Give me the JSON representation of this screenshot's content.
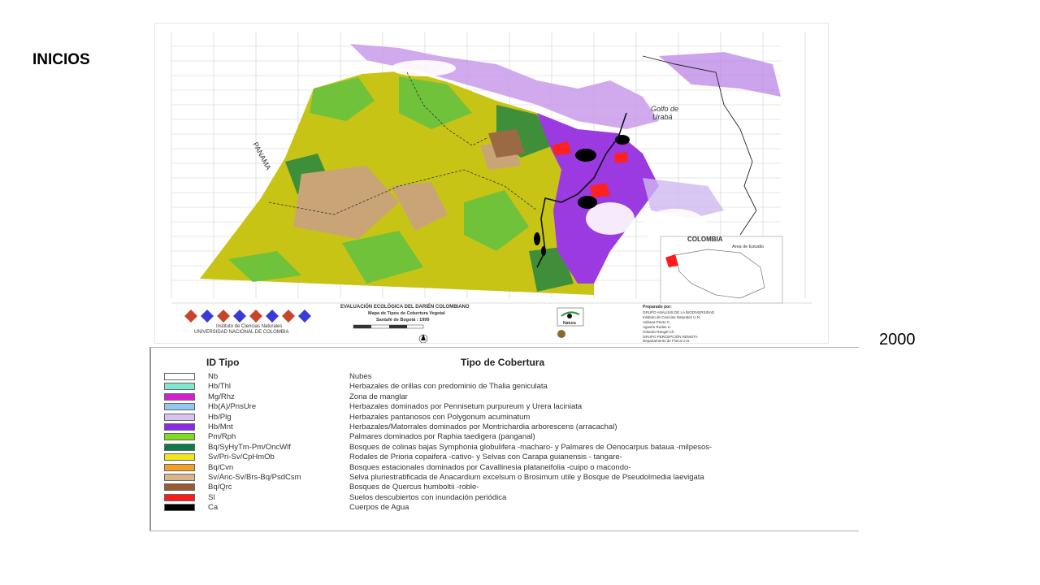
{
  "slide": {
    "title": "INICIOS",
    "year": "2000"
  },
  "map": {
    "country_label": "PANAMA",
    "gulf_label_line1": "Golfo de",
    "gulf_label_line2": "Urabá",
    "inset_title": "COLOMBIA",
    "inset_subtitle": "Area de Estudio",
    "footer": {
      "project_title": "EVALUACIÓN ECOLÓGICA DEL DARIÉN COLOMBIANO",
      "map_title": "Mapa de Tipos de Cobertura Vegetal",
      "place_year": "Santafé de Bogotá : 1999",
      "institute_line1": "Instituto de Ciencias Naturales",
      "institute_line2": "UNIVERSIDAD NACIONAL DE COLOMBIA",
      "natura_label": "Natura",
      "prepared_label": "Preparado por:",
      "prepared_group": "GRUPO ANÁLISIS DE LA BIODIVERSIDAD",
      "prepared_institute": "Instituto de Ciencias Naturales U.N.",
      "author1": "Adriana Prieto C.",
      "author2": "Agustín Rudas Ll.",
      "author3": "Orlando Rangel Ch.",
      "sensing_group": "GRUPO PERCEPCIÓN REMOTA",
      "sensing_dept": "Departamento de Física U.N."
    }
  },
  "legend": {
    "header_id": "ID Tipo",
    "header_type": "Tipo de Cobertura",
    "items": [
      {
        "code": "Nb",
        "description": "Nubes",
        "color": "#ffffff"
      },
      {
        "code": "Hb/Thl",
        "description": "Herbazales de orillas con predominio de Thalia geniculata",
        "color": "#7ee8cf"
      },
      {
        "code": "Mg/Rhz",
        "description": "Zona de manglar",
        "color": "#d21fd2"
      },
      {
        "code": "Hb(A)/PnsUre",
        "description": "Herbazales dominados por Pennisetum purpureum y Urera laciniata",
        "color": "#93c9ef"
      },
      {
        "code": "Hb/Plg",
        "description": "Herbazales pantanosos con Polygonum acuminatum",
        "color": "#d7c3ef"
      },
      {
        "code": "Hb/Mnt",
        "description": "Herbazales/Matorrales dominados por Montrichardia arborescens (arracachal)",
        "color": "#8a2be2"
      },
      {
        "code": "Pm/Rph",
        "description": "Palmares dominados por Raphia taedigera (panganal)",
        "color": "#7ddc1f"
      },
      {
        "code": "Bq/SyHyTm-Pm/OncWlf",
        "description": "Bosques de colinas bajas Symphonia globulifera -macharo- y Palmares de Oenocarpus bataua -milpesos-",
        "color": "#0e7a4a"
      },
      {
        "code": "Sv/Pri-Sv/CpHmOb",
        "description": "Rodales de Prioria copaifera -cativo- y Selvas con Carapa guianensis - tangare-",
        "color": "#f2e51b"
      },
      {
        "code": "Bq/Cvn",
        "description": "Bosques estacionales dominados por Cavallinesia plataneifolia -cuipo o macondo-",
        "color": "#f4a024"
      },
      {
        "code": "Sv/Anc-Sv/Brs-Bq/PsdCsm",
        "description": "Selva pluriestratificada de Anacardium excelsum o Brosimum utile y Bosque de Pseudolmedia laevigata",
        "color": "#d9b58a"
      },
      {
        "code": "Bq/Qrc",
        "description": "Bosques de Quercus humboltii -roble-",
        "color": "#9a5a33"
      },
      {
        "code": "Sl",
        "description": "Suelos descubiertos con inundación periódica",
        "color": "#ff1a1a"
      },
      {
        "code": "Ca",
        "description": "Cuerpos de Agua",
        "color": "#000000"
      }
    ]
  }
}
